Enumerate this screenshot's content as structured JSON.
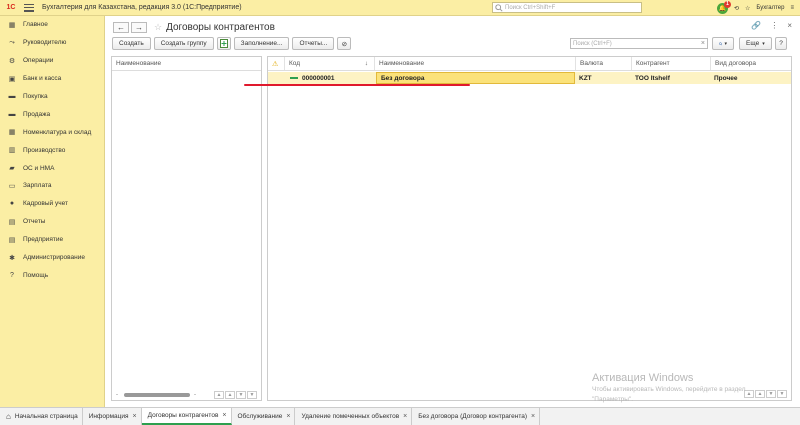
{
  "app": {
    "title": "Бухгалтерия для Казахстана, редакция 3.0  (1С:Предприятие)",
    "logo_text": "1С",
    "search_placeholder": "Поиск Ctrl+Shift+F",
    "notifications_count": "1",
    "user": "Бухгалтер"
  },
  "sidebar": {
    "items": [
      {
        "label": "Главное",
        "icon": "grid-icon"
      },
      {
        "label": "Руководителю",
        "icon": "chart-icon"
      },
      {
        "label": "Операции",
        "icon": "operations-icon"
      },
      {
        "label": "Банк и касса",
        "icon": "bank-icon"
      },
      {
        "label": "Покупка",
        "icon": "purchase-icon"
      },
      {
        "label": "Продажа",
        "icon": "sales-icon"
      },
      {
        "label": "Номенклатура и склад",
        "icon": "warehouse-icon"
      },
      {
        "label": "Производство",
        "icon": "production-icon"
      },
      {
        "label": "ОС и НМА",
        "icon": "assets-icon"
      },
      {
        "label": "Зарплата",
        "icon": "salary-icon"
      },
      {
        "label": "Кадровый учет",
        "icon": "hr-icon"
      },
      {
        "label": "Отчеты",
        "icon": "reports-icon"
      },
      {
        "label": "Предприятие",
        "icon": "enterprise-icon"
      },
      {
        "label": "Администрирование",
        "icon": "admin-icon"
      },
      {
        "label": "Помощь",
        "icon": "help-icon"
      }
    ]
  },
  "page": {
    "title": "Договоры контрагентов",
    "back": "←",
    "forward": "→",
    "star": "☆"
  },
  "toolbar": {
    "create": "Создать",
    "create_group": "Создать группу",
    "fill": "Заполнение...",
    "reports": "Отчеты...",
    "search_placeholder": "Поиск (Ctrl+F)",
    "more": "Еще",
    "help": "?"
  },
  "left_panel": {
    "column_header": "Наименование"
  },
  "table": {
    "columns": [
      "Код",
      "Наименование",
      "Валюта",
      "Контрагент",
      "Вид договора"
    ],
    "rows": [
      {
        "code": "000000001",
        "name": "Без договора",
        "currency": "KZT",
        "counterparty": "ТОО Itshelf",
        "kind": "Прочее"
      }
    ]
  },
  "tabs": [
    {
      "label": "Начальная страница",
      "closable": false,
      "active": false
    },
    {
      "label": "Информация",
      "closable": true,
      "active": false
    },
    {
      "label": "Договоры контрагентов",
      "closable": true,
      "active": true
    },
    {
      "label": "Обслуживание",
      "closable": true,
      "active": false
    },
    {
      "label": "Удаление помеченных объектов",
      "closable": true,
      "active": false
    },
    {
      "label": "Без договора (Договор контрагента)",
      "closable": true,
      "active": false
    }
  ],
  "watermark": {
    "line1": "Активация Windows",
    "line2": "Чтобы активировать Windows, перейдите в раздел",
    "line3": "\"Параметры\"."
  },
  "colors": {
    "header_bg": "#fbeea4",
    "selected_row": "#fdf3c4",
    "selected_cell": "#fbe27a",
    "annotation_red": "#e0192d",
    "active_tab_accent": "#2e9f4f"
  }
}
